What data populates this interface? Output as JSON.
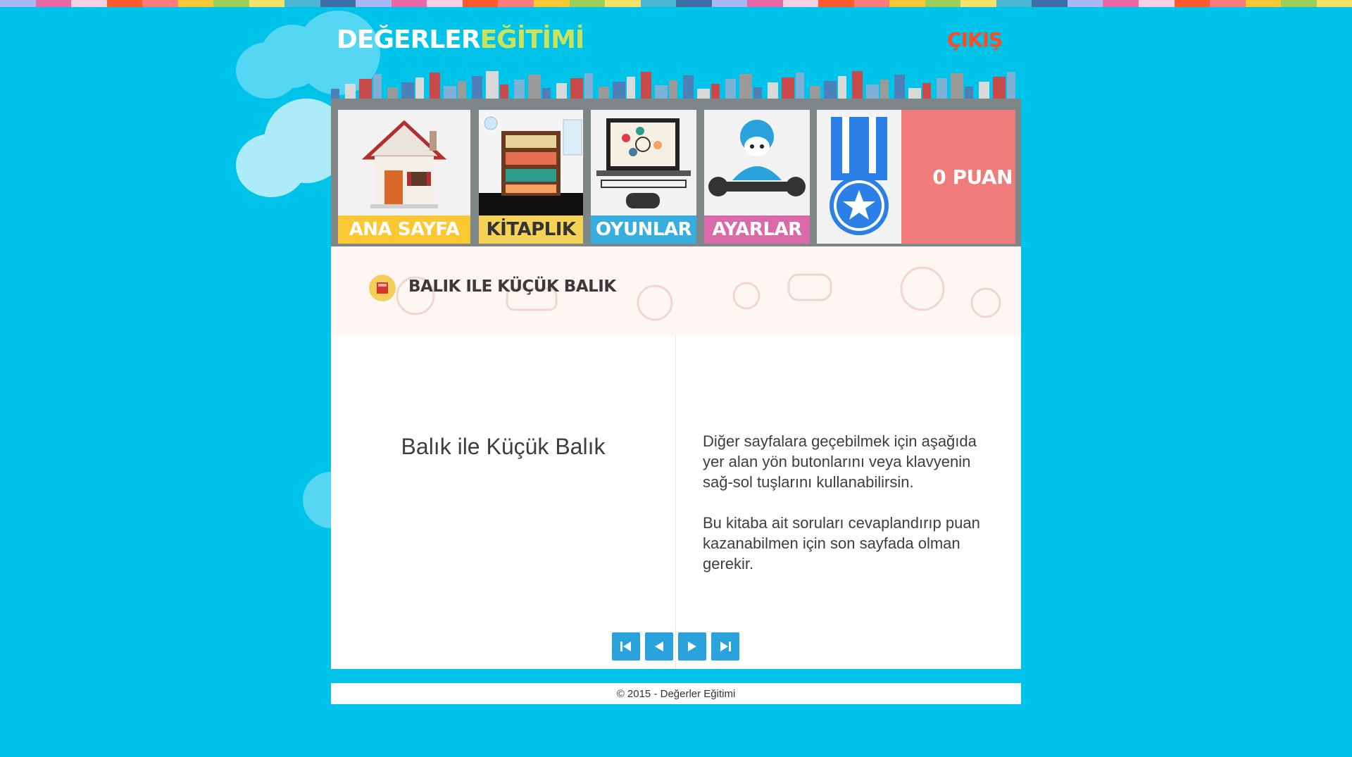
{
  "header": {
    "logo_part1": "DEĞERLER",
    "logo_part2": "EĞİTİMİ",
    "logout_label": "ÇIKIŞ"
  },
  "menu": {
    "items": [
      {
        "label": "ANA SAYFA",
        "color": "#f9c832"
      },
      {
        "label": "KİTAPLIK",
        "color": "#f7d258"
      },
      {
        "label": "OYUNLAR",
        "color": "#37aede"
      },
      {
        "label": "AYARLAR",
        "color": "#d969a8"
      }
    ],
    "score_label": "0 PUAN"
  },
  "book": {
    "title": "BALIK ILE KÜÇÜK BALIK",
    "left_page_title": "Balık ile Küçük Balık",
    "right_page_paragraphs": [
      "Diğer sayfalara geçebilmek için aşağıda yer alan yön butonlarını veya klavyenin sağ-sol tuşlarını kullanabilirsin.",
      "Bu kitaba ait soruları cevaplandırıp puan kazanabilmen için son sayfada olman gerekir."
    ]
  },
  "navigation": {
    "buttons": [
      {
        "name": "first-page",
        "icon": "skip-back-icon"
      },
      {
        "name": "previous-page",
        "icon": "play-left-icon"
      },
      {
        "name": "next-page",
        "icon": "play-right-icon"
      },
      {
        "name": "last-page",
        "icon": "skip-forward-icon"
      }
    ]
  },
  "footer": {
    "copyright": "© 2015 - Değerler Eğitimi"
  },
  "colors": {
    "background": "#00c3ea",
    "score_tile": "#f07b7b",
    "nav_button": "#2aa3dc",
    "logout": "#ff4b22"
  }
}
